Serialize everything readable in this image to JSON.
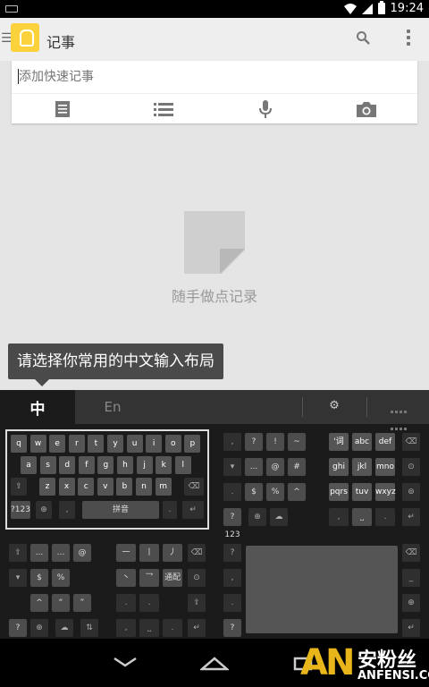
{
  "status": {
    "time": "19:24"
  },
  "app": {
    "title": "记事"
  },
  "note": {
    "placeholder": "添加快速记事"
  },
  "empty": {
    "message": "随手做点记录"
  },
  "tooltip": {
    "text": "请选择你常用的中文输入布局"
  },
  "ime": {
    "tab_zh": "中",
    "tab_en": "En",
    "qwerty_rows": [
      [
        "q",
        "w",
        "e",
        "r",
        "t",
        "y",
        "u",
        "i",
        "o",
        "p"
      ],
      [
        "a",
        "s",
        "d",
        "f",
        "g",
        "h",
        "j",
        "k",
        "l"
      ],
      [
        "z",
        "x",
        "c",
        "v",
        "b",
        "n",
        "m"
      ]
    ],
    "nine_rows": [
      [
        "'词",
        "abc",
        "def"
      ],
      [
        "ghi",
        "jkl",
        "mno"
      ],
      [
        "pqrs",
        "tuv",
        "wxyz"
      ]
    ],
    "sym_rows": [
      [
        "?",
        "!",
        "~"
      ],
      [
        "...",
        "@",
        "#"
      ],
      [
        "$",
        "%",
        "^"
      ]
    ],
    "stroke_keys": [
      "一",
      "丨",
      "丿",
      "丶",
      "乛",
      "通配"
    ],
    "space_label": "拼音",
    "num_label": "?123"
  },
  "watermark": {
    "an": "AN",
    "cn": "安粉丝",
    "en": "ANFENSI.COM"
  },
  "colors": {
    "accent": "#fbd23c",
    "watermark": "#e8b51a"
  }
}
